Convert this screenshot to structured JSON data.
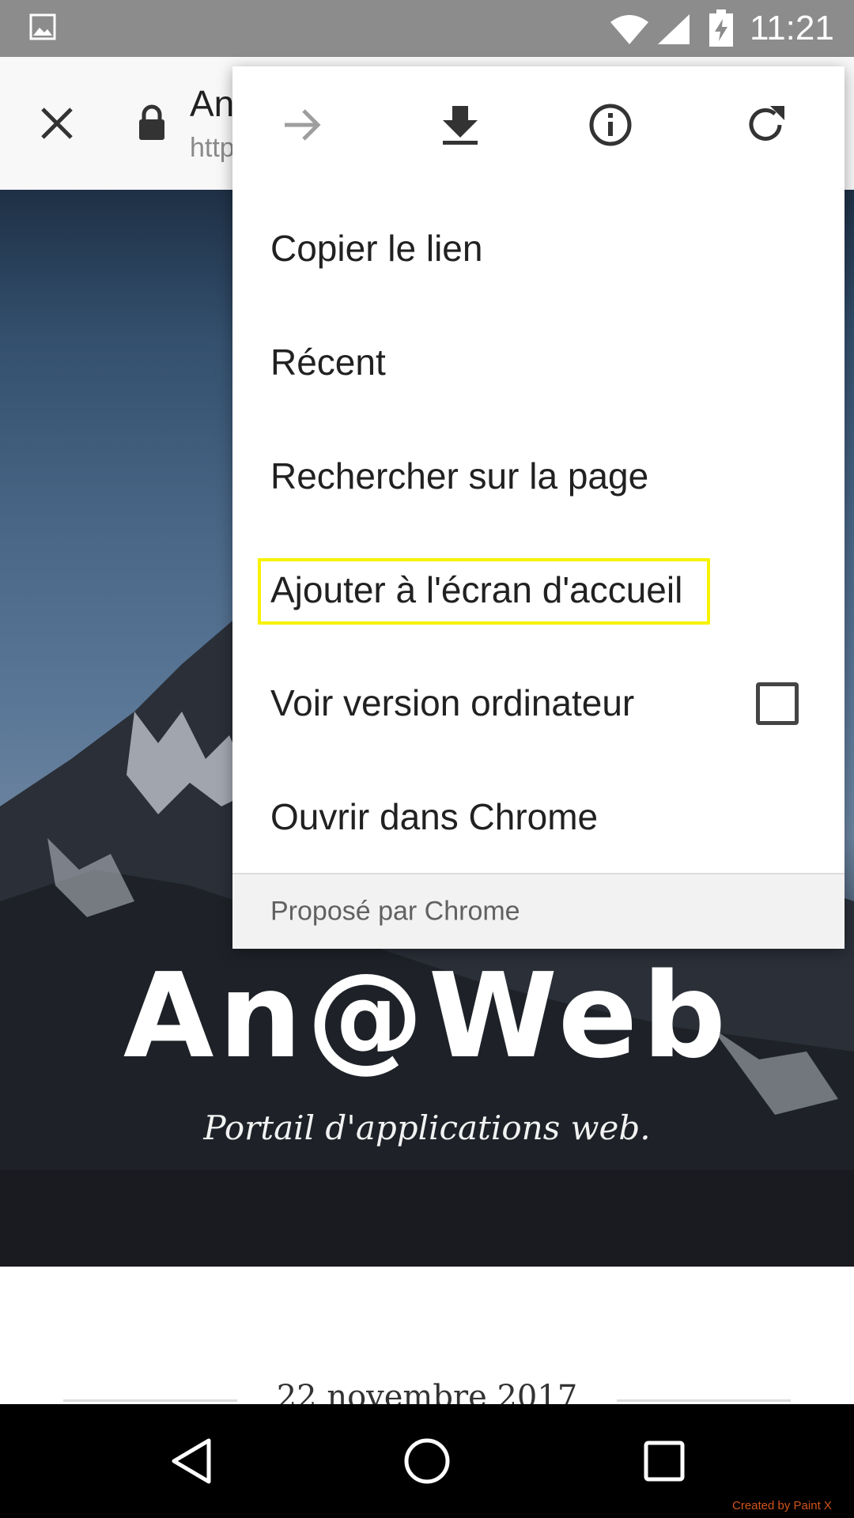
{
  "status_bar": {
    "time": "11:21",
    "icons": [
      "gallery-icon",
      "wifi-icon",
      "signal-icon",
      "battery-charging-icon"
    ],
    "background": "#8c8c8c"
  },
  "toolbar": {
    "title": "An",
    "url": "http",
    "close_icon": "close-icon",
    "lock_icon": "lock-icon"
  },
  "menu": {
    "icon_row": [
      "forward-icon",
      "download-icon",
      "info-icon",
      "refresh-icon"
    ],
    "items": [
      {
        "label": "Copier le lien"
      },
      {
        "label": "Récent"
      },
      {
        "label": "Rechercher sur la page"
      },
      {
        "label": "Ajouter à l'écran d'accueil",
        "highlighted": true
      },
      {
        "label": "Voir version ordinateur",
        "checkbox": true,
        "checked": false
      },
      {
        "label": "Ouvrir dans Chrome"
      }
    ],
    "footer": "Proposé par Chrome",
    "highlight_color": "#f7f200"
  },
  "page": {
    "logo": "An@Web",
    "tagline": "Portail d'applications web.",
    "date": "22 novembre 2017"
  },
  "nav_bar": {
    "icons": [
      "back-icon",
      "home-icon",
      "recents-icon"
    ]
  },
  "watermark": "Created by Paint X"
}
